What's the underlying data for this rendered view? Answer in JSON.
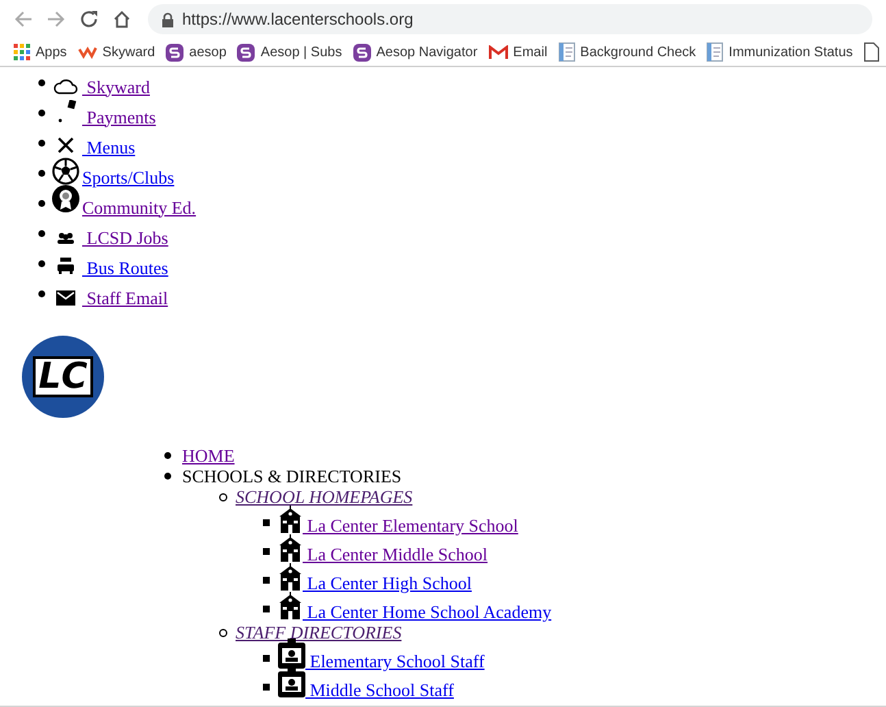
{
  "browser": {
    "url": "https://www.lacenterschools.org",
    "bookmarks": [
      {
        "label": "Apps",
        "kind": "apps"
      },
      {
        "label": "Skyward",
        "kind": "skyward"
      },
      {
        "label": "aesop",
        "kind": "aesop"
      },
      {
        "label": "Aesop | Subs",
        "kind": "aesop"
      },
      {
        "label": "Aesop Navigator",
        "kind": "aesop"
      },
      {
        "label": "Email",
        "kind": "mail"
      },
      {
        "label": "Background Check",
        "kind": "doc"
      },
      {
        "label": "Immunization Status",
        "kind": "doc"
      },
      {
        "kind": "page"
      }
    ]
  },
  "quick_links": [
    {
      "label": " Skyward",
      "kind": "cloud",
      "visited": true
    },
    {
      "label": " Payments",
      "kind": "payments",
      "visited": true
    },
    {
      "label": " Menus",
      "kind": "utensils",
      "visited": false
    },
    {
      "label": "Sports/Clubs",
      "kind": "ball",
      "visited": false
    },
    {
      "label": "Community Ed.",
      "kind": "award",
      "visited": true
    },
    {
      "label": " LCSD Jobs",
      "kind": "people",
      "visited": true
    },
    {
      "label": " Bus Routes",
      "kind": "bus",
      "visited": false
    },
    {
      "label": " Staff Email",
      "kind": "mail",
      "visited": true
    }
  ],
  "logo": {
    "text": "LC"
  },
  "menu": [
    {
      "label": "HOME",
      "kind": "link",
      "visited": true
    },
    {
      "label": "SCHOOLS & DIRECTORIES",
      "kind": "heading",
      "children": [
        {
          "label": "SCHOOL HOMEPAGES",
          "visited": true,
          "children": [
            {
              "label": " La Center Elementary School",
              "kind": "school",
              "visited": true
            },
            {
              "label": " La Center Middle School",
              "kind": "school",
              "visited": true
            },
            {
              "label": " La Center High School",
              "kind": "school",
              "visited": false
            },
            {
              "label": " La Center Home School Academy",
              "kind": "school",
              "visited": false
            }
          ]
        },
        {
          "label": "STAFF DIRECTORIES",
          "visited": true,
          "children": [
            {
              "label": " Elementary School Staff",
              "kind": "badge",
              "visited": false
            },
            {
              "label": " Middle School Staff",
              "kind": "badge",
              "visited": false
            }
          ]
        }
      ]
    }
  ]
}
